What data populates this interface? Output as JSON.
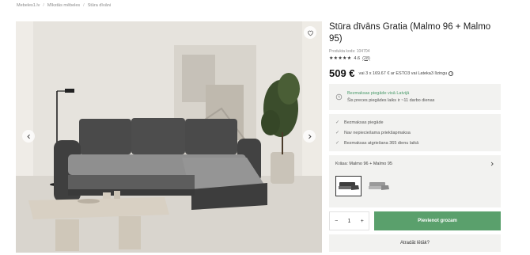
{
  "breadcrumb": [
    "Mebeles1.lv",
    "Mīkstās mēbeles",
    "Stūra dīvāni"
  ],
  "product": {
    "title": "Stūra dīvāns Gratia (Malmo 96 + Malmo 95)",
    "code": "Produkta kods: 104704",
    "stars": "★★★★★",
    "rating": "4.6",
    "rating_count": "(28)",
    "price": "509 €",
    "installment": "vai 3 x 169.67 € ar ESTO3 vai Lateka3 līzingu"
  },
  "delivery": {
    "line1": "Bezmaksas piegāde visā Latvijā",
    "line2": "Šis preces piegādes laiks ir ~11 darbo dienas"
  },
  "benefits": [
    "Bezmaksas piegāde",
    "Nav nepieciešama priekšapmaksa",
    "Bezmaksas atgriešana 365 dienu laikā"
  ],
  "color": {
    "label": "Krāsa: Malmo 96 + Malmo 95"
  },
  "cart": {
    "minus": "−",
    "quantity": "1",
    "plus": "+",
    "add_label": "Pievienot grozam"
  },
  "cheaper_label": "Atradāt lētāk?",
  "colors": {
    "accent": "#5aa06c",
    "panel": "#f2f2f0"
  }
}
